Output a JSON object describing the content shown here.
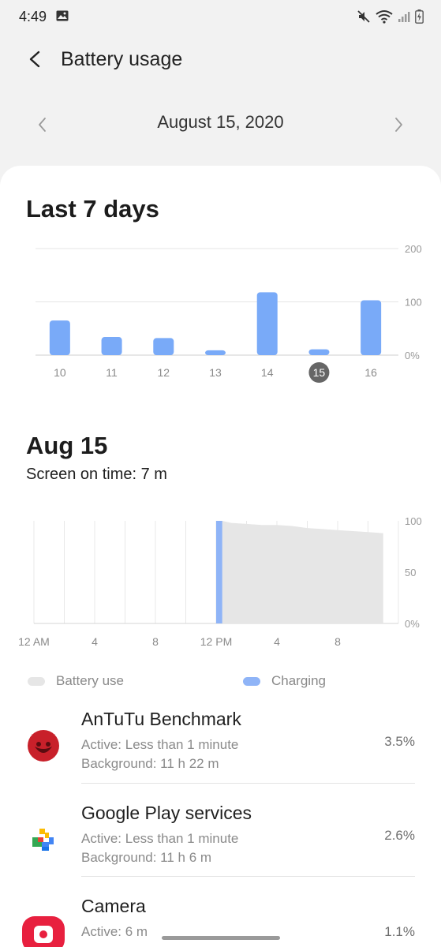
{
  "status_bar": {
    "time": "4:49",
    "icons": [
      "image-icon",
      "mute-icon",
      "wifi-icon",
      "signal-icon",
      "battery-icon"
    ]
  },
  "app_bar": {
    "title": "Battery usage",
    "back_icon": "back-arrow-icon"
  },
  "date_nav": {
    "date": "August 15, 2020",
    "prev_icon": "chevron-left-icon",
    "next_icon": "chevron-right-icon"
  },
  "colors": {
    "accent_bar": "#79aaf8",
    "charging": "#8fb4f7",
    "battery_use": "#e6e6e6",
    "selected_day": "#666666"
  },
  "week": {
    "title": "Last 7 days",
    "chart_data": {
      "type": "bar",
      "categories": [
        "10",
        "11",
        "12",
        "13",
        "14",
        "15",
        "16"
      ],
      "values": [
        65,
        34,
        32,
        9,
        118,
        11,
        103
      ],
      "y_ticks": [
        "200",
        "100",
        "0%"
      ],
      "ylim": [
        0,
        200
      ],
      "selected_category": "15"
    }
  },
  "day": {
    "title": "Aug 15",
    "screen_on": "Screen on time: 7 m",
    "chart_data": {
      "type": "area",
      "x_ticks": [
        "12 AM",
        "4",
        "8",
        "12 PM",
        "4",
        "8"
      ],
      "y_ticks": [
        "100",
        "50",
        "0%"
      ],
      "ylim": [
        0,
        100
      ],
      "x_hours": [
        12,
        12.4,
        13,
        14,
        15,
        16,
        17,
        18,
        19,
        20,
        21,
        22,
        23
      ],
      "battery_level": [
        100,
        100,
        98,
        97,
        96,
        96,
        95,
        93,
        92,
        91,
        90,
        89,
        88
      ],
      "charging_window_hours": [
        12,
        12.4
      ]
    }
  },
  "legend": [
    {
      "label": "Battery use",
      "color": "#e6e6e6"
    },
    {
      "label": "Charging",
      "color": "#8fb4f7"
    }
  ],
  "apps": [
    {
      "name": "AnTuTu Benchmark",
      "active": "Active: Less than 1 minute",
      "background": "Background: 11 h 22 m",
      "percent": "3.5%",
      "icon": "antutu-icon"
    },
    {
      "name": "Google Play services",
      "active": "Active: Less than 1 minute",
      "background": "Background: 11 h 6 m",
      "percent": "2.6%",
      "icon": "google-play-services-icon"
    },
    {
      "name": "Camera",
      "active": "Active: 6 m",
      "background": "",
      "percent": "1.1%",
      "icon": "camera-icon"
    }
  ]
}
